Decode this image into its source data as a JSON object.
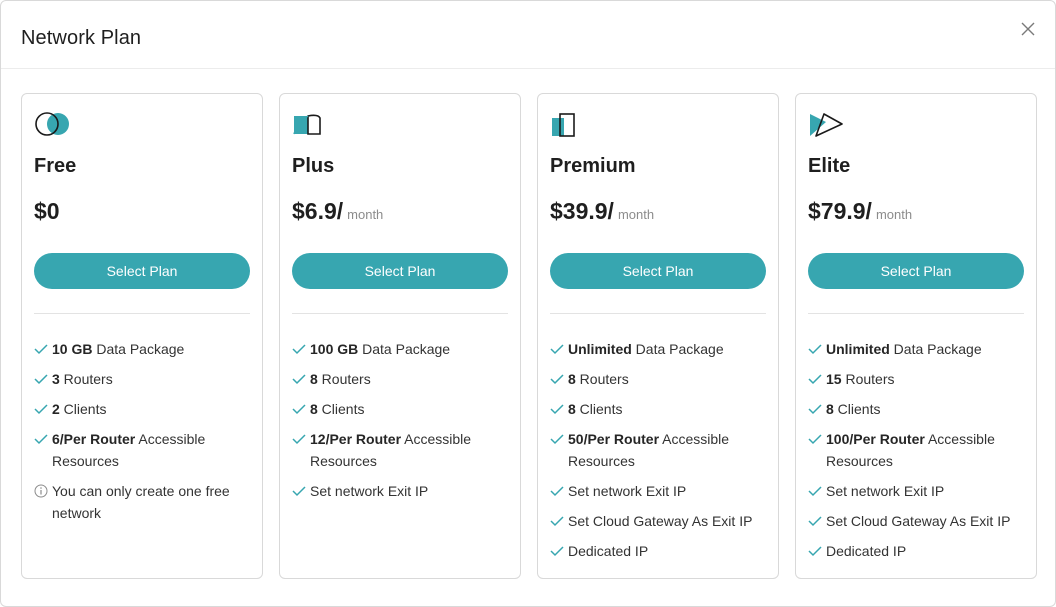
{
  "modal": {
    "title": "Network Plan"
  },
  "colors": {
    "accent": "#37a6b0",
    "check": "#37a6b0"
  },
  "plans": [
    {
      "name": "Free",
      "icon": "circles-icon",
      "price": "$0",
      "period": "",
      "button_label": "Select Plan",
      "features": [
        {
          "icon": "check-icon",
          "strong": "10 GB",
          "text": " Data Package"
        },
        {
          "icon": "check-icon",
          "strong": "3",
          "text": " Routers"
        },
        {
          "icon": "check-icon",
          "strong": "2",
          "text": " Clients"
        },
        {
          "icon": "check-icon",
          "strong": "6/Per Router",
          "text": " Accessible Resources"
        },
        {
          "icon": "info-icon",
          "strong": "",
          "text": "You can only create one free network"
        }
      ]
    },
    {
      "name": "Plus",
      "icon": "quarter-shape-icon",
      "price": "$6.9/",
      "period": "month",
      "button_label": "Select Plan",
      "features": [
        {
          "icon": "check-icon",
          "strong": "100 GB",
          "text": " Data Package"
        },
        {
          "icon": "check-icon",
          "strong": "8",
          "text": " Routers"
        },
        {
          "icon": "check-icon",
          "strong": "8",
          "text": " Clients"
        },
        {
          "icon": "check-icon",
          "strong": "12/Per Router",
          "text": " Accessible Resources"
        },
        {
          "icon": "check-icon",
          "strong": "",
          "text": "Set network Exit IP"
        }
      ]
    },
    {
      "name": "Premium",
      "icon": "squares-icon",
      "price": "$39.9/",
      "period": "month",
      "button_label": "Select Plan",
      "features": [
        {
          "icon": "check-icon",
          "strong": "Unlimited",
          "text": " Data Package"
        },
        {
          "icon": "check-icon",
          "strong": "8",
          "text": " Routers"
        },
        {
          "icon": "check-icon",
          "strong": "8",
          "text": " Clients"
        },
        {
          "icon": "check-icon",
          "strong": "50/Per Router",
          "text": " Accessible Resources"
        },
        {
          "icon": "check-icon",
          "strong": "",
          "text": "Set network Exit IP"
        },
        {
          "icon": "check-icon",
          "strong": "",
          "text": "Set Cloud Gateway As Exit IP"
        },
        {
          "icon": "check-icon",
          "strong": "",
          "text": "Dedicated IP"
        }
      ]
    },
    {
      "name": "Elite",
      "icon": "triangles-icon",
      "price": "$79.9/",
      "period": "month",
      "button_label": "Select Plan",
      "features": [
        {
          "icon": "check-icon",
          "strong": "Unlimited",
          "text": " Data Package"
        },
        {
          "icon": "check-icon",
          "strong": "15",
          "text": " Routers"
        },
        {
          "icon": "check-icon",
          "strong": "8",
          "text": " Clients"
        },
        {
          "icon": "check-icon",
          "strong": "100/Per Router",
          "text": " Accessible Resources"
        },
        {
          "icon": "check-icon",
          "strong": "",
          "text": "Set network Exit IP"
        },
        {
          "icon": "check-icon",
          "strong": "",
          "text": "Set Cloud Gateway As Exit IP"
        },
        {
          "icon": "check-icon",
          "strong": "",
          "text": "Dedicated IP"
        }
      ]
    }
  ]
}
